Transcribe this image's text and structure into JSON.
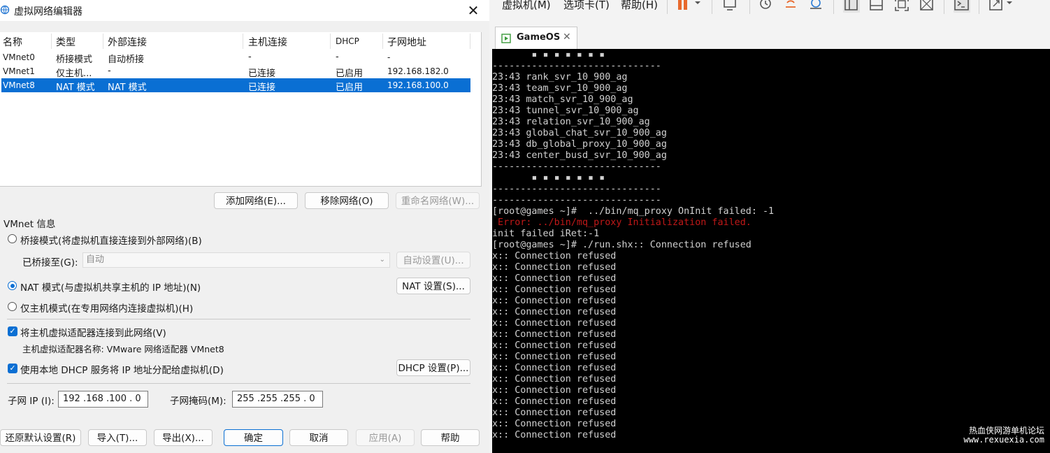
{
  "dialog": {
    "title": "虚拟网络编辑器",
    "close_glyph": "✕",
    "table": {
      "headers": [
        "名称",
        "类型",
        "外部连接",
        "主机连接",
        "DHCP",
        "子网地址"
      ],
      "rows": [
        [
          "VMnet0",
          "桥接模式",
          "自动桥接",
          "-",
          "-",
          "-"
        ],
        [
          "VMnet1",
          "仅主机...",
          "-",
          "已连接",
          "已启用",
          "192.168.182.0"
        ],
        [
          "VMnet8",
          "NAT 模式",
          "NAT 模式",
          "已连接",
          "已启用",
          "192.168.100.0"
        ]
      ],
      "selected_row": 2
    },
    "buttons": {
      "add_network": "添加网络(E)...",
      "remove_network": "移除网络(O)",
      "rename_network": "重命名网络(W)..."
    },
    "vmnet_info": {
      "section_label": "VMnet 信息",
      "bridged_label": "桥接模式(将虚拟机直接连接到外部网络)(B)",
      "bridged_to_label": "已桥接至(G):",
      "bridged_to_value": "自动",
      "auto_settings": "自动设置(U)...",
      "nat_label": "NAT 模式(与虚拟机共享主机的 IP 地址)(N)",
      "nat_settings": "NAT 设置(S)...",
      "host_only_label": "仅主机模式(在专用网络内连接虚拟机)(H)",
      "connect_adapter_label": "将主机虚拟适配器连接到此网络(V)",
      "adapter_name_label": "主机虚拟适配器名称: VMware 网络适配器 VMnet8",
      "dhcp_label": "使用本地 DHCP 服务将 IP 地址分配给虚拟机(D)",
      "dhcp_settings": "DHCP 设置(P)...",
      "subnet_ip_label": "子网 IP (I):",
      "subnet_ip": "192 .168 .100 .  0",
      "subnet_mask_label": "子网掩码(M):",
      "subnet_mask": "255 .255 .255 .  0"
    },
    "footer": {
      "restore_defaults": "还原默认设置(R)",
      "import": "导入(T)...",
      "export": "导出(X)...",
      "ok": "确定",
      "cancel": "取消",
      "apply": "应用(A)",
      "help": "帮助"
    }
  },
  "vm": {
    "menu": [
      "虚拟机(M)",
      "选项卡(T)",
      "帮助(H)"
    ],
    "tab_label": "GameOS",
    "tab_close": "✕",
    "terminal_lines": [
      {
        "text": "       ▪ ▪ ▪ ▪ ▪ ▪ ▪",
        "err": false
      },
      {
        "text": "------------------------------",
        "err": false
      },
      {
        "text": "23:43 rank_svr_10_900_ag",
        "err": false
      },
      {
        "text": "23:43 team_svr_10_900_ag",
        "err": false
      },
      {
        "text": "23:43 match_svr_10_900_ag",
        "err": false
      },
      {
        "text": "23:43 tunnel_svr_10_900_ag",
        "err": false
      },
      {
        "text": "23:43 relation_svr_10_900_ag",
        "err": false
      },
      {
        "text": "23:43 global_chat_svr_10_900_ag",
        "err": false
      },
      {
        "text": "23:43 db_global_proxy_10_900_ag",
        "err": false
      },
      {
        "text": "23:43 center_busd_svr_10_900_ag",
        "err": false
      },
      {
        "text": "------------------------------",
        "err": false
      },
      {
        "text": "       ▪ ▪ ▪ ▪ ▪ ▪ ▪",
        "err": false
      },
      {
        "text": "------------------------------",
        "err": false
      },
      {
        "text": "------------------------------",
        "err": false
      },
      {
        "text": "[root@games ~]#  ../bin/mq_proxy OnInit failed: -1",
        "err": false
      },
      {
        "text": " Error: ../bin/mq_proxy Initialization failed.",
        "err": true
      },
      {
        "text": "init failed iRet:-1",
        "err": false
      },
      {
        "text": "[root@games ~]# ./run.shx:: Connection refused",
        "err": false
      },
      {
        "text": "x:: Connection refused",
        "err": false
      },
      {
        "text": "x:: Connection refused",
        "err": false
      },
      {
        "text": "x:: Connection refused",
        "err": false
      },
      {
        "text": "x:: Connection refused",
        "err": false
      },
      {
        "text": "x:: Connection refused",
        "err": false
      },
      {
        "text": "x:: Connection refused",
        "err": false
      },
      {
        "text": "x:: Connection refused",
        "err": false
      },
      {
        "text": "x:: Connection refused",
        "err": false
      },
      {
        "text": "x:: Connection refused",
        "err": false
      },
      {
        "text": "x:: Connection refused",
        "err": false
      },
      {
        "text": "x:: Connection refused",
        "err": false
      },
      {
        "text": "x:: Connection refused",
        "err": false
      },
      {
        "text": "x:: Connection refused",
        "err": false
      },
      {
        "text": "x:: Connection refused",
        "err": false
      },
      {
        "text": "x:: Connection refused",
        "err": false
      },
      {
        "text": "x:: Connection refused",
        "err": false
      },
      {
        "text": "x:: Connection refused",
        "err": false
      }
    ],
    "watermark_line1": "热血侠网游单机论坛",
    "watermark_line2": "www.rexuexia.com"
  },
  "colors": {
    "selection": "#0a6fd3",
    "pause_icon": "#e8692c",
    "terminal_bg": "#000000",
    "terminal_error": "#c01818"
  },
  "icons": [
    "network-icon",
    "close-icon",
    "pause-icon",
    "snapshot-icon",
    "revert-icon",
    "manage-snapshot-icon",
    "console-icon",
    "fullscreen-icon",
    "unity-icon"
  ]
}
